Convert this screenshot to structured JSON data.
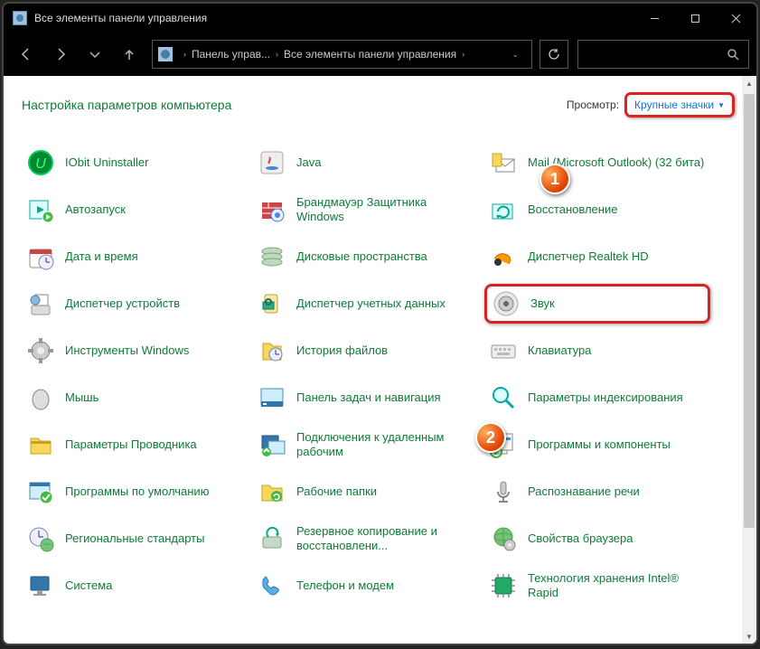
{
  "window": {
    "title": "Все элементы панели управления"
  },
  "breadcrumb": {
    "items": [
      "Панель управ...",
      "Все элементы панели управления"
    ]
  },
  "page": {
    "title": "Настройка параметров компьютера",
    "view_label": "Просмотр:",
    "view_value": "Крупные значки"
  },
  "callouts": {
    "one": "1",
    "two": "2"
  },
  "items": [
    {
      "label": "IObit Uninstaller",
      "icon": "iobit"
    },
    {
      "label": "Java",
      "icon": "java"
    },
    {
      "label": "Mail (Microsoft Outlook) (32 бита)",
      "icon": "mail"
    },
    {
      "label": "Автозапуск",
      "icon": "autoplay"
    },
    {
      "label": "Брандмауэр Защитника Windows",
      "icon": "firewall"
    },
    {
      "label": "Восстановление",
      "icon": "recovery"
    },
    {
      "label": "Дата и время",
      "icon": "datetime"
    },
    {
      "label": "Дисковые пространства",
      "icon": "disks"
    },
    {
      "label": "Диспетчер Realtek HD",
      "icon": "realtek"
    },
    {
      "label": "Диспетчер устройств",
      "icon": "devmgr"
    },
    {
      "label": "Диспетчер учетных данных",
      "icon": "credmgr"
    },
    {
      "label": "Звук",
      "icon": "sound",
      "highlighted": true
    },
    {
      "label": "Инструменты Windows",
      "icon": "tools"
    },
    {
      "label": "История файлов",
      "icon": "filehist"
    },
    {
      "label": "Клавиатура",
      "icon": "keyboard"
    },
    {
      "label": "Мышь",
      "icon": "mouse"
    },
    {
      "label": "Панель задач и навигация",
      "icon": "taskbar"
    },
    {
      "label": "Параметры индексирования",
      "icon": "indexing"
    },
    {
      "label": "Параметры Проводника",
      "icon": "explorer"
    },
    {
      "label": "Подключения к удаленным рабочим",
      "icon": "remote"
    },
    {
      "label": "Программы и компоненты",
      "icon": "programs"
    },
    {
      "label": "Программы по умолчанию",
      "icon": "defaults"
    },
    {
      "label": "Рабочие папки",
      "icon": "workfolders"
    },
    {
      "label": "Распознавание речи",
      "icon": "speech"
    },
    {
      "label": "Региональные стандарты",
      "icon": "region"
    },
    {
      "label": "Резервное копирование и восстановлени...",
      "icon": "backup"
    },
    {
      "label": "Свойства браузера",
      "icon": "inetopt"
    },
    {
      "label": "Система",
      "icon": "system"
    },
    {
      "label": "Телефон и модем",
      "icon": "phone"
    },
    {
      "label": "Технология хранения Intel® Rapid",
      "icon": "intel"
    }
  ]
}
